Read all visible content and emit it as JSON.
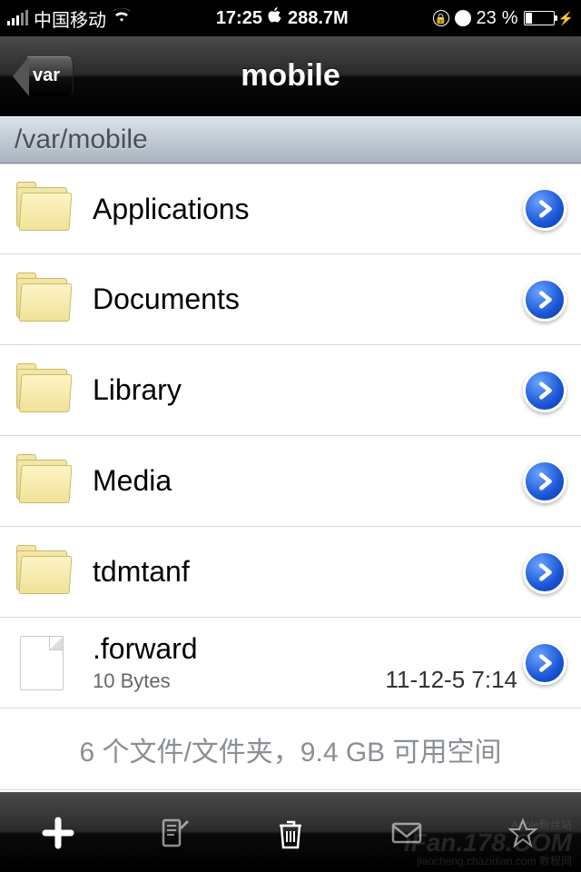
{
  "status": {
    "carrier": "中国移动",
    "time": "17:25",
    "memory": "288.7M",
    "battery_percent": "23",
    "battery_suffix": "%"
  },
  "nav": {
    "back_label": "var",
    "title": "mobile"
  },
  "path": "/var/mobile",
  "items": [
    {
      "name": "Applications",
      "type": "folder"
    },
    {
      "name": "Documents",
      "type": "folder"
    },
    {
      "name": "Library",
      "type": "folder"
    },
    {
      "name": "Media",
      "type": "folder"
    },
    {
      "name": "tdmtanf",
      "type": "folder"
    },
    {
      "name": ".forward",
      "type": "file",
      "size": "10 Bytes",
      "date": "11-12-5 7:14"
    }
  ],
  "summary": "6 个文件/文件夹，9.4 GB 可用空间",
  "watermark": {
    "brand": "iFan.178.COM",
    "sub1": "Apple粉丝站",
    "sub2": "jiaocheng.chazidian.com 教程网"
  }
}
